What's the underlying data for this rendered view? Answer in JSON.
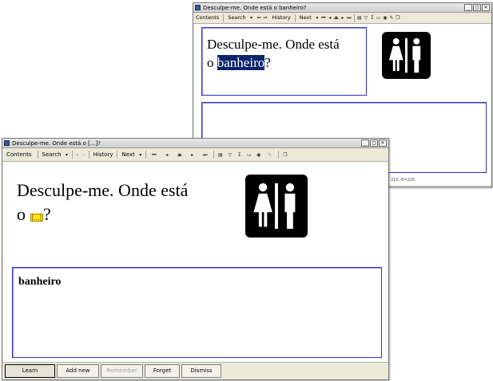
{
  "back_window": {
    "title": "Desculpe-me. Onde está o banheiro?",
    "toolbar": {
      "contents": "Contents",
      "search": "Search",
      "arrows": "⇐ ⇒",
      "history": "History",
      "next": "Next"
    },
    "question_prefix": "Desculpe-me. Onde está",
    "question_o": "o ",
    "question_word": "banheiro",
    "question_suffix": "?",
    "status": "215, H=215"
  },
  "front_window": {
    "title": "Desculpe-me. Onde está o [...]?",
    "toolbar": {
      "contents": "Contents",
      "search": "Search",
      "back": "‹",
      "fwd": "›",
      "history": "History",
      "next": "Next"
    },
    "question_line1": "Desculpe-me. Onde está",
    "question_o": "o ",
    "cloze": "[...]",
    "question_suffix": "?",
    "answer": "banheiro",
    "buttons": {
      "learn": "Learn",
      "add_new": "Add new",
      "remember": "Remember",
      "forget": "Forget",
      "dismiss": "Dismiss"
    }
  },
  "window_controls": {
    "minimize": "_",
    "maximize": "□",
    "close": "×"
  },
  "icons": [
    "restroom-icon",
    "toolbar-nav-icons"
  ]
}
